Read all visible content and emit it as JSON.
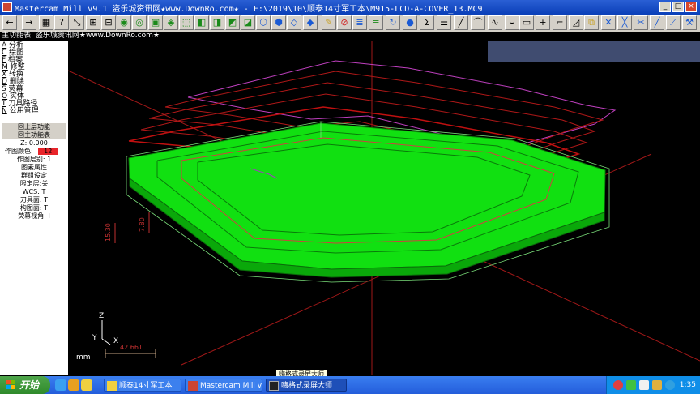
{
  "window": {
    "title": "Mastercam Mill v9.1 盗乐城资讯网★www.DownRo.com★ - F:\\2019\\10\\顺泰14寸军工本\\M915-LCD-A-COVER_13.MC9",
    "min": "_",
    "max": "□",
    "close": "×"
  },
  "menu_title": "主功能表: 盗乐城资讯网★www.DownRo.com★",
  "menu_items": [
    {
      "key": "A",
      "label": "分析"
    },
    {
      "key": "C",
      "label": "绘图"
    },
    {
      "key": "F",
      "label": "档案"
    },
    {
      "key": "M",
      "label": "修整"
    },
    {
      "key": "X",
      "label": "转换"
    },
    {
      "key": "D",
      "label": "删除"
    },
    {
      "key": "S",
      "label": "荧幕"
    },
    {
      "key": "O",
      "label": "实体"
    },
    {
      "key": "T",
      "label": "刀具路径"
    },
    {
      "key": "N",
      "label": "公用管理"
    }
  ],
  "panel": {
    "back_up": "回上层功能",
    "back_main": "回主功能表",
    "z_label": "Z:",
    "z_value": "0.000",
    "color_label": "作图颜色:",
    "color_value": "12",
    "color_swatch": "#e8242a",
    "level_label": "作图层别:",
    "level_value": "1",
    "attr": "图素属性",
    "group": "群组设定",
    "limit_label": "限定层:",
    "limit_value": "关",
    "wcs_label": "WCS:",
    "wcs_value": "T",
    "tplane_label": "刀具面:",
    "tplane_value": "T",
    "cplane_label": "构图面:",
    "cplane_value": "T",
    "gview_label": "荧幕视角:",
    "gview_value": "I"
  },
  "viewport": {
    "dim_a": "15.30",
    "dim_b": "7.80",
    "dim_c": "42.661",
    "axis_z": "Z",
    "axis_y": "Y",
    "axis_x": "X",
    "units": "mm"
  },
  "tooltip": "嗨格式录屏大师",
  "taskbar": {
    "start": "开始",
    "tasks": [
      {
        "label": "顺泰14寸军工本",
        "icon": "folder-icon",
        "active": false
      },
      {
        "label": "Mastercam Mill v...",
        "icon": "mastercam-icon",
        "active": false
      },
      {
        "label": "嗨格式录屏大师",
        "icon": "recorder-icon",
        "active": true
      }
    ],
    "clock": "1:35"
  },
  "colors": {
    "title_bar": "#0a3fb8",
    "part_fill": "#11e011",
    "toolpath": "#b01818",
    "upper_path": "#c040c0",
    "axis": "#b02020",
    "taskbar": "#245ddb"
  },
  "toolbar_icons": [
    "back-arrow-icon",
    "forward-arrow-icon",
    "calculator-icon",
    "help-icon",
    "zoom-region-icon",
    "zoom-window-icon",
    "unzoom-icon",
    "view-top-icon",
    "view-front-icon",
    "view-side-icon",
    "view-iso-icon",
    "view-cube-1-icon",
    "view-cube-2-icon",
    "view-cube-3-icon",
    "view-cube-4-icon",
    "view-cube-5-icon",
    "view-cube-6-icon",
    "view-cube-7-icon",
    "view-cube-8-icon",
    "eraser-icon",
    "no-entry-icon",
    "layers-icon",
    "rotate-icon",
    "sphere-icon",
    "menu-sigma-icon",
    "line-icon",
    "arc-icon",
    "spline-icon",
    "rectangle-icon",
    "plus-icon",
    "fillet-icon",
    "stack-icon",
    "cross-1-icon",
    "cross-2-icon",
    "slash-icon",
    "diagonal-icon",
    "tool-icon"
  ]
}
